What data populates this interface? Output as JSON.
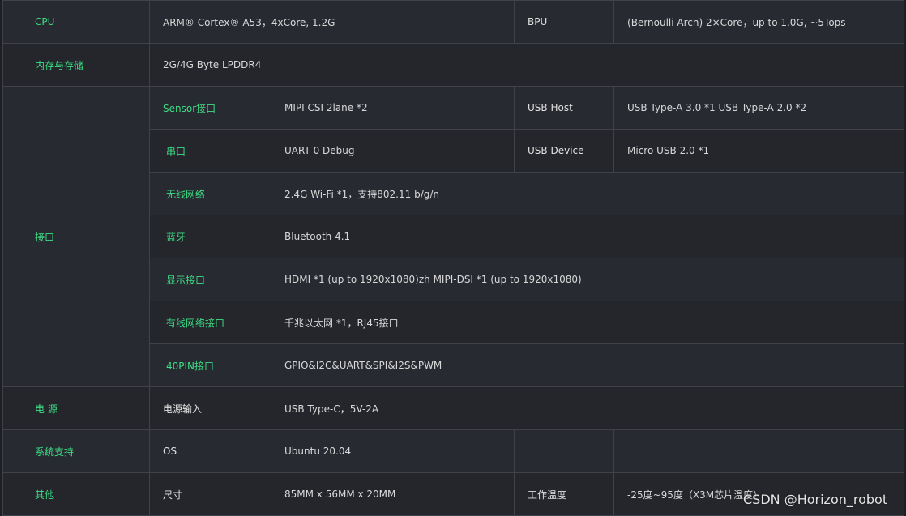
{
  "rows": {
    "cpu": {
      "label": "CPU",
      "value": "ARM® Cortex®-A53，4xCore, 1.2G",
      "label2": "BPU",
      "value2": "(Bernoulli Arch) 2×Core，up to 1.0G, ~5Tops"
    },
    "memory": {
      "label": "内存与存储",
      "value": "2G/4G Byte LPDDR4"
    },
    "interfaces": {
      "label": "接口",
      "sensor": {
        "label": "Sensor接口",
        "value": "MIPI CSI 2lane *2",
        "label2": "USB Host",
        "value2": "USB Type-A 3.0 *1 USB Type-A 2.0 *2"
      },
      "serial": {
        "label": "串口",
        "value": "UART 0 Debug",
        "label2": "USB Device",
        "value2": "Micro USB 2.0 *1"
      },
      "wifi": {
        "label": "无线网络",
        "value": "2.4G Wi-Fi *1，支持802.11 b/g/n"
      },
      "bluetooth": {
        "label": "蓝牙",
        "value": "Bluetooth 4.1"
      },
      "display": {
        "label": "显示接口",
        "value": "HDMI *1 (up to 1920x1080)zh MIPI-DSI *1 (up to 1920x1080)"
      },
      "ethernet": {
        "label": "有线网络接口",
        "value": "千兆以太网 *1，RJ45接口"
      },
      "pin40": {
        "label": "40PIN接口",
        "value": "GPIO&I2C&UART&SPI&I2S&PWM"
      }
    },
    "power": {
      "label": "电 源",
      "sublabel": "电源输入",
      "value": "USB Type-C，5V-2A"
    },
    "system": {
      "label": "系统支持",
      "sublabel": "OS",
      "value": "Ubuntu 20.04"
    },
    "other": {
      "label": "其他",
      "sublabel": "尺寸",
      "value": "85MM x 56MM x 20MM",
      "label2": "工作温度",
      "value2": "-25度~95度（X3M芯片温度）"
    }
  },
  "watermark": "CSDN @Horizon_robot",
  "colors": {
    "background": "#1e1f24",
    "accent": "#3ddc84",
    "border": "#404248",
    "text": "#d8d8d8"
  }
}
